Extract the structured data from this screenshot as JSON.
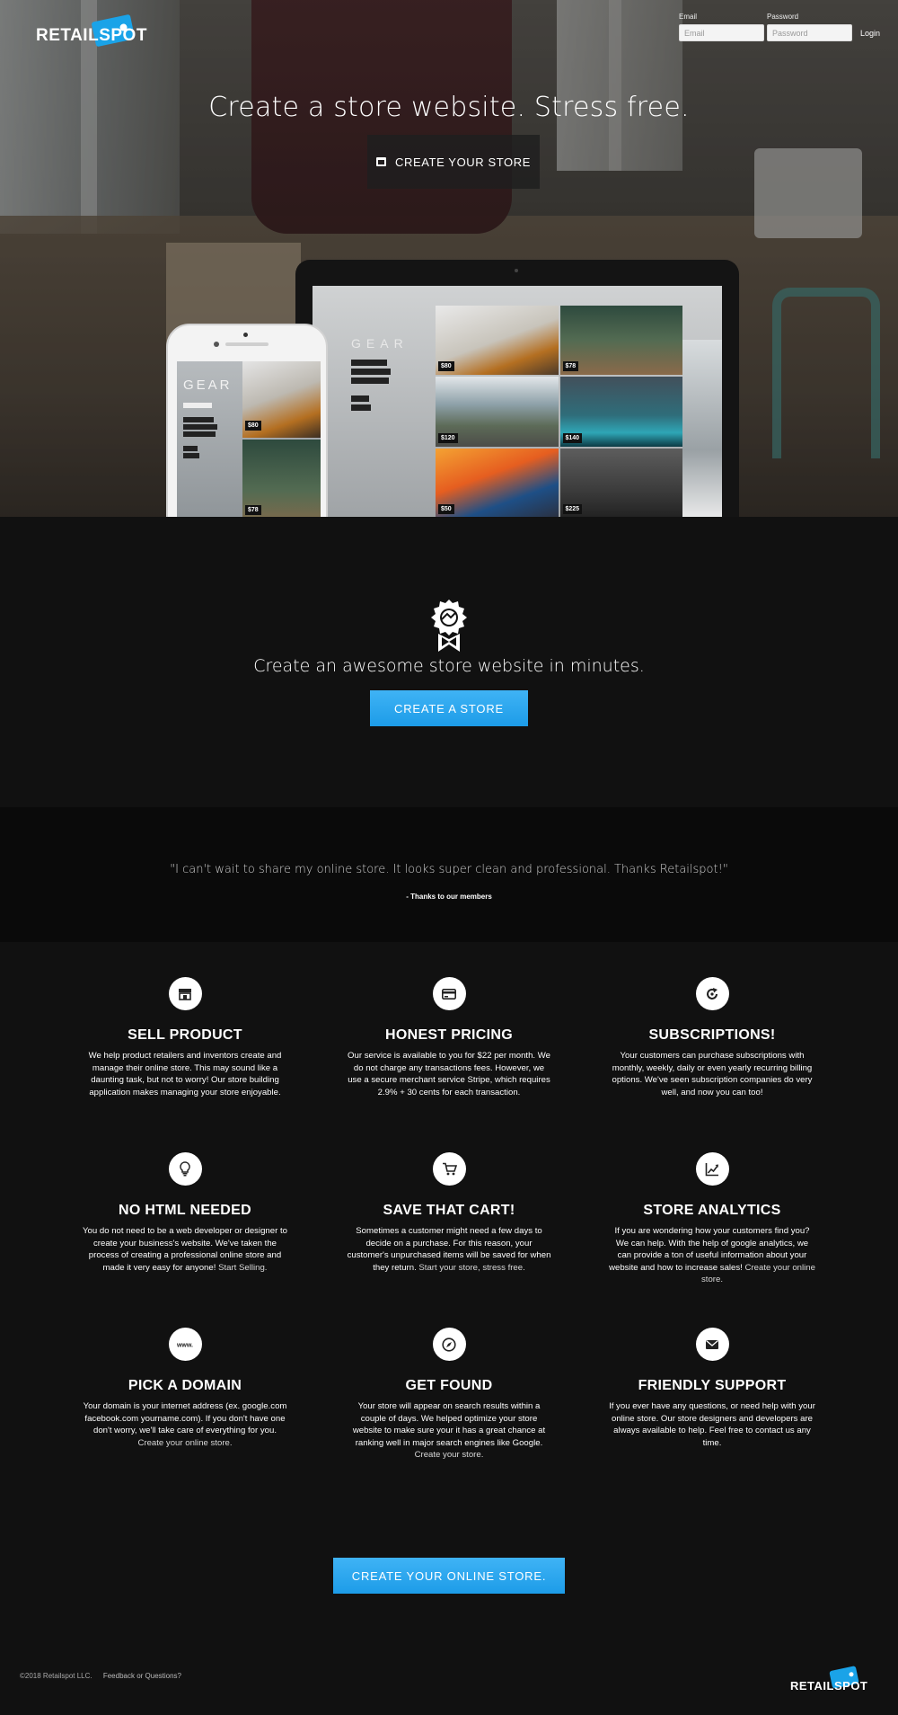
{
  "brand": {
    "name": "RETAILSPOT"
  },
  "login": {
    "email_label": "Email",
    "email_placeholder": "Email",
    "password_label": "Password",
    "password_placeholder": "Password",
    "button": "Login"
  },
  "hero": {
    "title": "Create a store website. Stress free.",
    "cta": "CREATE YOUR STORE",
    "cta_icon": "store-icon"
  },
  "mockup": {
    "site_title": "GEAR",
    "prices": [
      "$80",
      "$78",
      "$120",
      "$140",
      "$50",
      "$225"
    ],
    "phone_prices": [
      "$80",
      "$78"
    ]
  },
  "awesome": {
    "icon": "award-ribbon-icon",
    "title": "Create an awesome store website in minutes.",
    "button": "CREATE A STORE"
  },
  "testimonial": {
    "quote": "\"I can't wait to share my online store. It looks super clean and professional. Thanks Retailspot!\"",
    "attribution": "- Thanks to our members"
  },
  "features": [
    {
      "icon": "storefront-icon",
      "title": "SELL PRODUCT",
      "text": "We help product retailers and inventors create and manage their online store. This may sound like a daunting task, but not to worry! Our store building application makes managing your store enjoyable.",
      "link": ""
    },
    {
      "icon": "credit-card-icon",
      "title": "HONEST PRICING",
      "text": "Our service is available to you for $22 per month. We do not charge any transactions fees. However, we use a secure merchant service Stripe, which requires 2.9% + 30 cents for each transaction.",
      "link": ""
    },
    {
      "icon": "refresh-icon",
      "title": "SUBSCRIPTIONS!",
      "text": "Your customers can purchase subscriptions with monthly, weekly, daily or even yearly recurring billing options. We've seen subscription companies do very well, and now you can too!",
      "link": ""
    },
    {
      "icon": "lightbulb-icon",
      "title": "NO HTML NEEDED",
      "text": "You do not need to be a web developer or designer to create your business's website. We've taken the process of creating a professional online store and made it very easy for anyone!",
      "link": "Start Selling."
    },
    {
      "icon": "cart-icon",
      "title": "SAVE THAT CART!",
      "text": "Sometimes a customer might need a few days to decide on a purchase. For this reason, your customer's unpurchased items will be saved for when they return.",
      "link": "Start your store, stress free."
    },
    {
      "icon": "chart-icon",
      "title": "STORE ANALYTICS",
      "text": "If you are wondering how your customers find you? We can help. With the help of google analytics, we can provide a ton of useful information about your website and how to increase sales!",
      "link": "Create your online store."
    },
    {
      "icon": "www-icon",
      "title": "PICK A DOMAIN",
      "text": "Your domain is your internet address (ex. google.com facebook.com yourname.com). If you don't have one don't worry, we'll take care of everything for you.",
      "link": "Create your online store."
    },
    {
      "icon": "compass-icon",
      "title": "GET FOUND",
      "text": "Your store will appear on search results within a couple of days. We helped optimize your store website to make sure your it has a great chance at ranking well in major search engines like Google.",
      "link": "Create your store."
    },
    {
      "icon": "envelope-icon",
      "title": "FRIENDLY SUPPORT",
      "text": "If you ever have any questions, or need help with your online store. Our store designers and developers are always available to help. Feel free to contact us any time.",
      "link": ""
    }
  ],
  "bottom_cta": "CREATE YOUR ONLINE STORE.",
  "footer": {
    "copyright": "©2018 Retailspot LLC.",
    "feedback": "Feedback or Questions?",
    "brand": "RETAILSPOT"
  },
  "colors": {
    "accent": "#1d9ce8",
    "background": "#111111",
    "quote_background": "#0a0a0a"
  }
}
